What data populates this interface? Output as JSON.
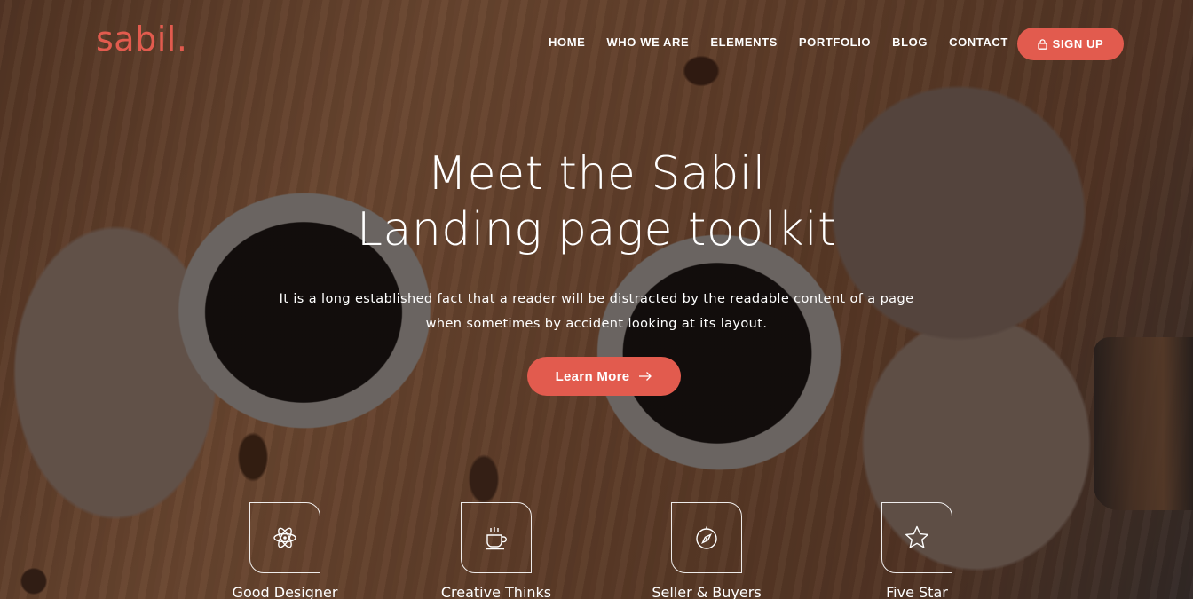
{
  "brand": {
    "logo_text": "sabil.",
    "accent_color": "#e25b4e"
  },
  "nav": {
    "items": [
      {
        "label": "HOME"
      },
      {
        "label": "WHO WE ARE"
      },
      {
        "label": "ELEMENTS"
      },
      {
        "label": "PORTFOLIO"
      },
      {
        "label": "BLOG"
      },
      {
        "label": "CONTACT"
      }
    ],
    "signup": {
      "label": "SIGN UP",
      "icon": "lock-icon"
    }
  },
  "hero": {
    "title_line1": "Meet the Sabil",
    "title_line2": "Landing page toolkit",
    "text_line1": "It is a long established fact that a reader will be distracted by the readable content of a page",
    "text_line2": "when sometimes by accident looking at its layout.",
    "cta": {
      "label": "Learn More",
      "icon": "arrow-right-icon"
    }
  },
  "features": [
    {
      "label": "Good Designer",
      "icon": "atom-icon"
    },
    {
      "label": "Creative Thinks",
      "icon": "coffee-cup-icon"
    },
    {
      "label": "Seller & Buyers",
      "icon": "compass-icon"
    },
    {
      "label": "Five Star",
      "icon": "star-icon"
    }
  ]
}
